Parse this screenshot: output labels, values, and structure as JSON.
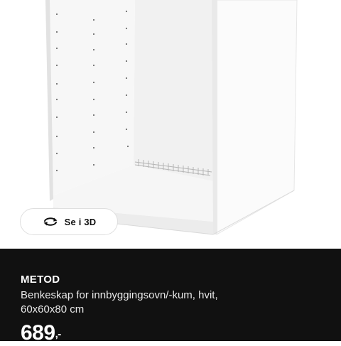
{
  "product_image": {
    "alt": "METOD",
    "view_3d_label": "Se i 3D",
    "view_3d_icon": "rotate-360-icon"
  },
  "product": {
    "name": "METOD",
    "description_line1": "Benkeskap for innbyggingsovn/-kum, hvit,",
    "description_line2": "60x60x80 cm",
    "price": "689",
    "price_suffix": ",-"
  },
  "colors": {
    "panel_background": "#111111",
    "panel_text": "#ffffff",
    "cabinet_white": "#ffffff"
  }
}
